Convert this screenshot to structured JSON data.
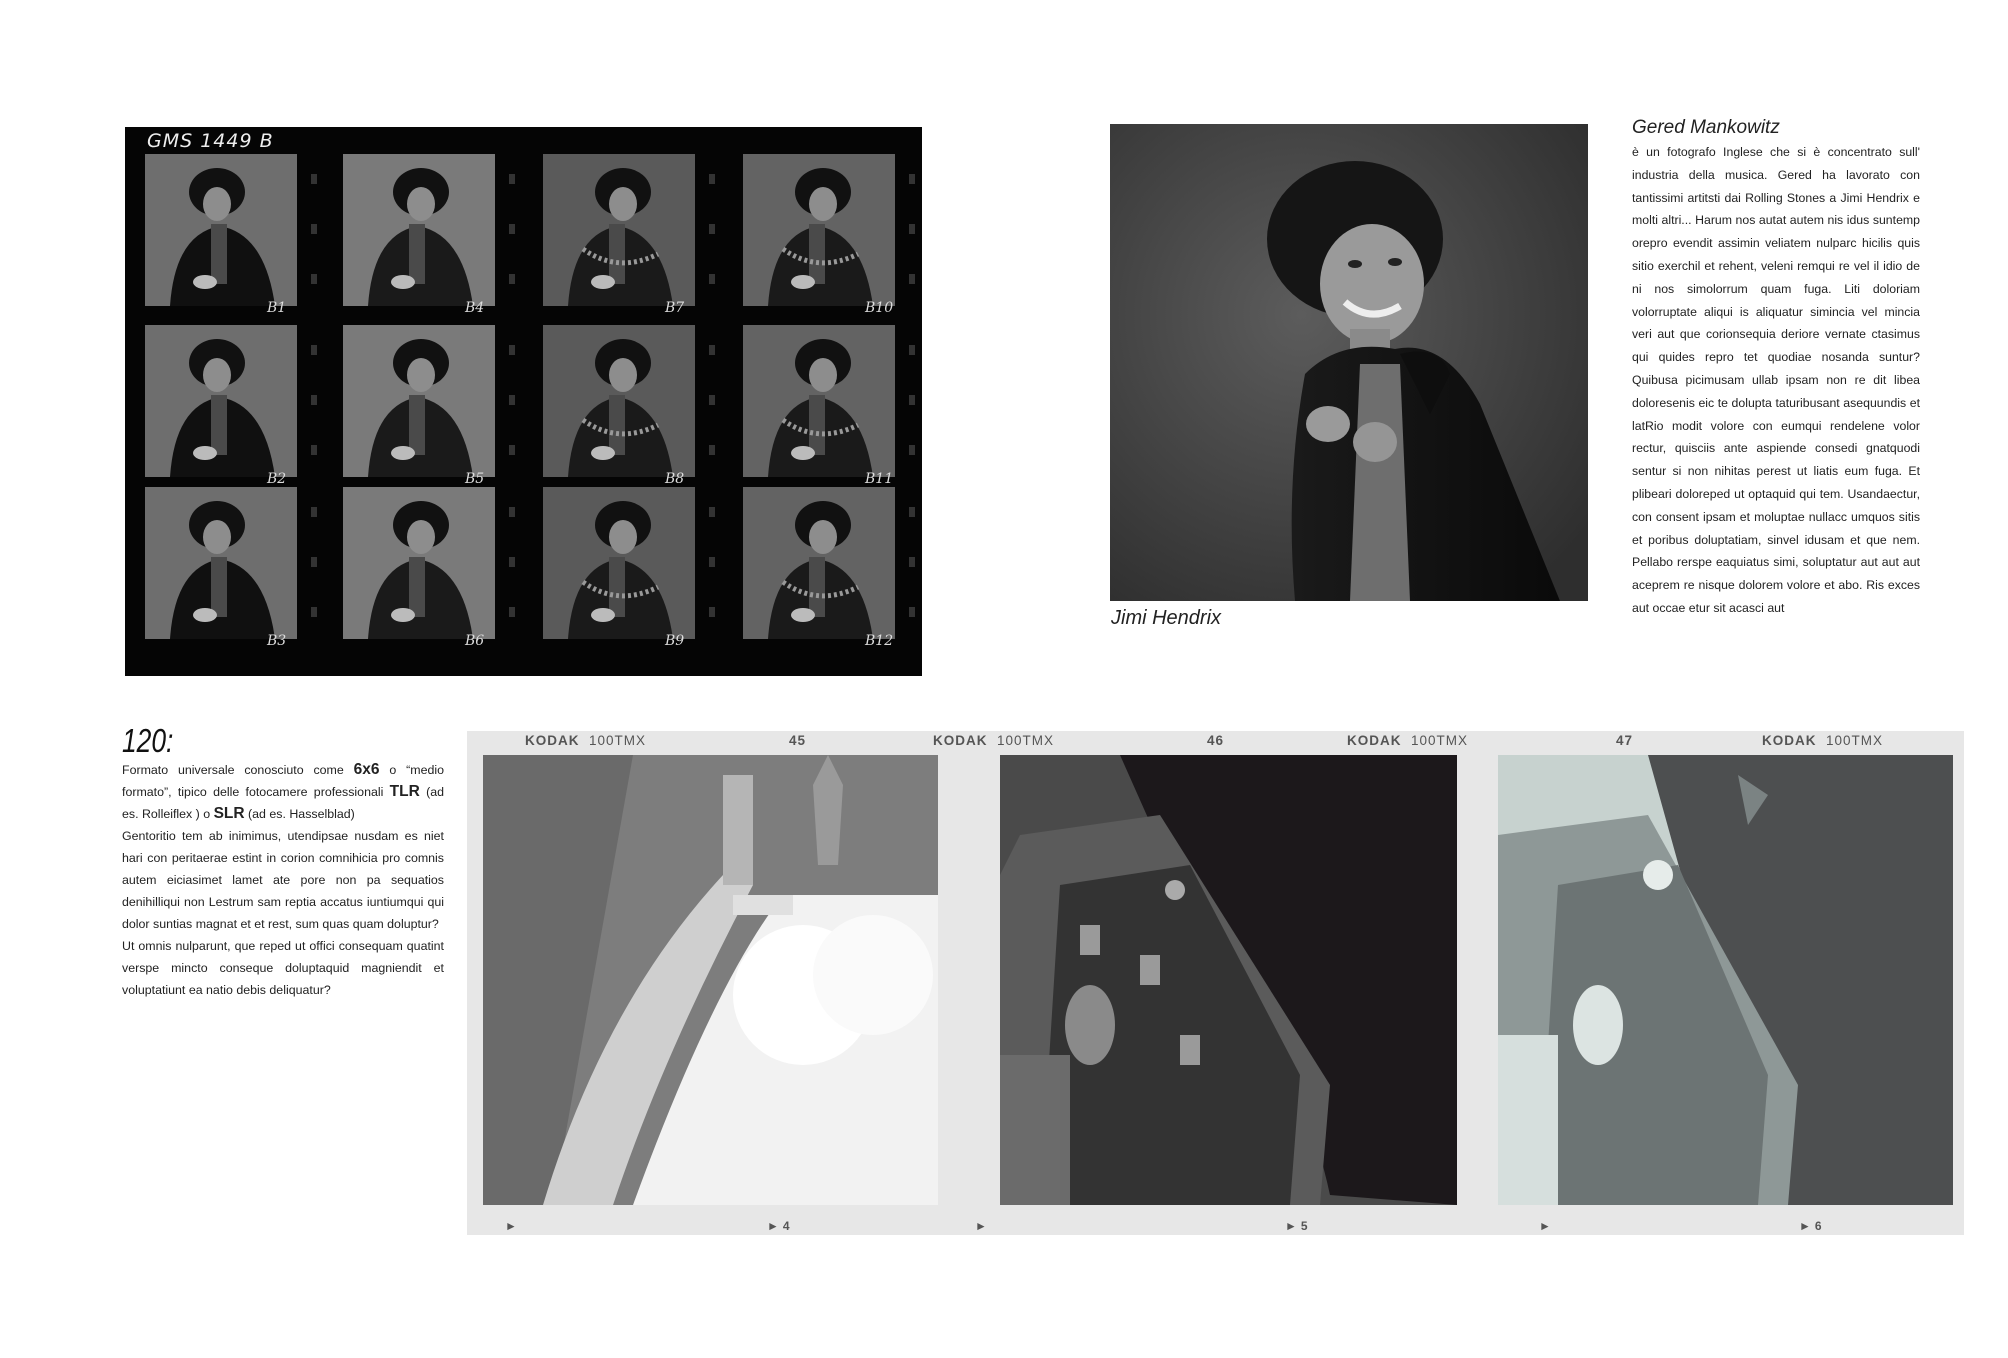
{
  "contact_sheet": {
    "code": "GMS 1449 B",
    "frame_labels": [
      "B1",
      "B4",
      "B7",
      "B10",
      "B2",
      "B5",
      "B8",
      "B11",
      "B3",
      "B6",
      "B9",
      "B12"
    ]
  },
  "portrait": {
    "caption": "Jimi Hendrix"
  },
  "bio": {
    "name": "Gered Mankowitz",
    "text": "è un fotografo Inglese che si è concentrato sull' industria della musica. Gered ha lavorato con tantissimi artitsti dai Rolling Stones a Jimi Hendrix e molti altri... Harum nos autat autem nis idus suntemp orepro evendit assimin veliatem nulparc hicilis quis sitio exerchil et rehent, veleni remqui re vel il idio de ni nos simolorrum quam fuga. Liti doloriam volorruptate aliqui is aliquatur simincia vel mincia veri aut que corionsequia deriore vernate ctasimus qui quides repro tet quodiae nosanda suntur? Quibusa picimusam ullab ipsam non re dit libea doloresenis eic te dolupta taturibusant asequundis et latRio modit volore con eumqui rendelene volor rectur, quisciis ante aspiende consedi gnatquodi sentur si non nihitas perest ut liatis eum fuga. Et plibeari doloreped ut optaquid qui tem. Usandaectur, con consent ipsam et moluptae nullacc umquos sitis et poribus doluptatiam, sinvel idusam et que nem. Pellabo rerspe eaquiatus simi, soluptatur aut aut aut aceprem re nisque dolorem volore et abo. Ris exces aut occae etur sit acasci aut"
  },
  "format_120": {
    "heading": "120:",
    "intro_a": "Formato universale conosciuto come ",
    "b1": "6x6",
    "intro_b": " o “medio formato”, tipico delle fotocamere professionali ",
    "b2": "TLR",
    "intro_c": " (ad es. Rolleiflex ) o ",
    "b3": "SLR",
    "intro_d": " (ad es. Hasselblad)",
    "para2": "Gentoritio tem ab inimimus, utendipsae nusdam es niet hari con peritaerae estint in corion comnihicia pro comnis autem eiciasimet lamet ate pore non pa sequatios denihilliqui non Lestrum sam reptia accatus iuntiumqui qui dolor suntias magnat et et rest, sum quas quam doluptur?",
    "para3": "Ut omnis nulparunt, que reped ut offici consequam quatint verspe mincto conseque doluptaquid magniendit et voluptatiunt ea natio debis deliquatur?"
  },
  "negative_strip": {
    "edge": [
      {
        "brand": "KODAK",
        "stock": "100TMX"
      },
      {
        "num": "45"
      },
      {
        "brand": "KODAK",
        "stock": "100TMX"
      },
      {
        "num": "46"
      },
      {
        "brand": "KODAK",
        "stock": "100TMX"
      },
      {
        "num": "47"
      },
      {
        "brand": "KODAK",
        "stock": "100TMX"
      }
    ],
    "frames": [
      "4",
      "5",
      "6"
    ]
  }
}
